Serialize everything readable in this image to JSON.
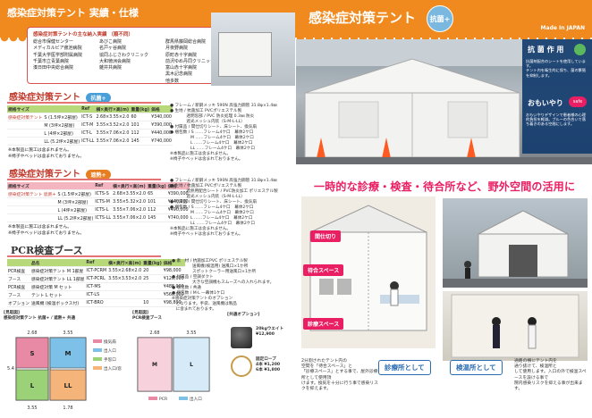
{
  "left": {
    "header_title": "感染症対策テント 実績・仕様",
    "hospital_box_title": "感染症対策テントの主な納入実績 （順不同）",
    "hospitals": [
      "総合市保健センター",
      "あびこ病院",
      "群馬県藤岡総合病院",
      "メディカルビア菰池病院",
      "名戸ヶ谷病院",
      "月夜野病院",
      "千葉大学医学部附属病院",
      "協同ふじさわクリニック",
      "原町赤十字病院",
      "千葉市立青葉病院",
      "大和徳洲会病院",
      "前沢ゆめ丹同クリニック",
      "湊日田中央総合病院",
      "雑井共病院",
      "富山赤十字病院",
      "",
      "",
      "黒木記念病院",
      "",
      "",
      "他多数"
    ],
    "section1_title": "感染症対策テント",
    "section1_badge": "抗菌+",
    "section2_title": "感染症対策テント",
    "section2_badge": "遮熱+",
    "section3_title": "PCR検査ブース",
    "table1": {
      "headers": [
        "規格サイズ",
        "",
        "Ref",
        "横×奥行×高(m)",
        "重量(kg)",
        "価格"
      ],
      "group_label": "感染症対策テント",
      "rows": [
        [
          "S (1.5坪×2部屋)",
          "ICT-S",
          "2.68×3.55×2.0",
          "60",
          "¥340,000"
        ],
        [
          "M (3坪×2部屋)",
          "ICT-M",
          "3.55×3.52×2.0",
          "101",
          "¥390,000"
        ],
        [
          "L (4坪×2部屋)",
          "ICT-L",
          "3.55×7.06×2.0",
          "112",
          "¥440,000"
        ],
        [
          "LL (5.2坪×2部屋)",
          "ICT-LL",
          "3.55×7.06×2.0",
          "145",
          "¥740,000"
        ]
      ],
      "note": "※本製品に施工は含まれません。\n※椅子やベッドは含まれておりません。"
    },
    "table2": {
      "headers": [
        "規格サイズ",
        "",
        "Ref",
        "横×奥行×高(m)",
        "重量(kg)",
        "価格"
      ],
      "group_label": "感染症対策テント 遮熱+",
      "rows": [
        [
          "S (1.5坪×2部屋)",
          "ICTS-S",
          "2.68×3.55×2.0",
          "65",
          "¥390,000"
        ],
        [
          "M (3坪×2部屋)",
          "ICTS-M",
          "3.55×5.32×2.0",
          "101",
          "¥440,000"
        ],
        [
          "L (4坪×2部屋)",
          "ICTS-L",
          "3.55×7.06×2.0",
          "112",
          "¥490,000"
        ],
        [
          "LL (5.2坪×2部屋)",
          "ICTS-LL",
          "3.55×7.06×2.0",
          "145",
          "¥740,000"
        ]
      ],
      "note": "※本製品に施工は含まれません。\n※椅子やベッドは含まれておりません。"
    },
    "spec1": "● フレーム / 新鋼メッキ 590N 高強力鋼管 31.8φ×1.4㎜\n● 生地 / 抗菌加工 PVCポリエステル製\n　　　　透明窓部 / PVC 防炎処理 0.3㎜ 防炎\n　　　　遮光メッシュ内装（S-M-L-LL）\n● 付属品 / 間仕切りシート、床シート、換気扇\n● 梱包数 / S ……フレーム4ケ口　幕体2ケ口\n　　　　　M ……フレーム4ケ口　幕体2ケ口\n　　　　　L ……フレーム4ケ口　幕体2ケ口\n　　　　　LL ……フレーム4ケ口　幕体2ケ口\n※本製品に施工は含まれません。\n※椅子やベッドは含まれておりません。",
    "spec2": "● フレーム / 新鋼メッキ 590N 高強力鋼管 31.8φ×1.4㎜\n● 生地 / 抗菌加工 PVCポリエステル製\n　　　　遮熱用配合シート / PVC防炎加工 ポリエステル製\n　　　　遮光メッシュ内装（S-M-L-LL）\n● 付属品 / 間仕切りシート、床シート、換気扇\n● 梱包数 / S ……フレーム4ケ口　幕体2ケ口\n　　　　　M ……フレーム4ケ口　幕体2ケ口\n　　　　　L ……フレーム4ケ口　幕体2ケ口\n　　　　　LL ……フレーム4ケ口　幕体2ケ口\n※本製品に施工は含まれません。\n※椅子やベッドは含まれておりません。",
    "pcr_table": {
      "headers": [
        "",
        "品名",
        "Ref",
        "横×奥行×高(m)",
        "重量(kg)",
        "価格"
      ],
      "rows": [
        [
          "PCR検査",
          "感染症対策テント M 1部屋",
          "ICT-PCRM",
          "3.55×2.68×2.0",
          "20",
          "¥98,000"
        ],
        [
          "ブース",
          "感染症対策テント LL 1部屋",
          "ICT-PCRL",
          "3.55×3.53×2.0",
          "25",
          "¥120,000"
        ],
        [
          "PCR検査",
          "感染症対策  M セット",
          "ICT-MS",
          "",
          "",
          "¥488,000"
        ],
        [
          "ブース",
          "テント  L セット",
          "ICT-LS",
          "",
          "",
          "¥560,000"
        ],
        [
          "オプション",
          "送風機 (検温ボックス付)",
          "ICT-BRO",
          "",
          "10",
          "¥98,800"
        ]
      ]
    },
    "pcr_spec": "● 素　材 / 抗菌加工PVC ポリエステル製\n　　　　　送風機(検温用) 送風口×1か所\n　　　　　スポットクーラー用送風口×1か所\n● 付属品 / 空調ダクト\n　　　　　大きな空調機もスムーズへの入れられます。\n● 梱包数 / 共通\n● 梱包数 / M·L ―幕体1ケ口\n※感染症対策テントのオプション\n　となります。手袋、送風機は製品\n　に含まれております。",
    "plan1_title": "[見取図]\n感染症対策テント 抗菌+ / 遮熱+ 共通",
    "plan2_title": "[見取図]\nPCR検査ブース",
    "plan_legend": [
      "換気扇",
      "出入口",
      "手窓口",
      "出入口/窓",
      "PCR"
    ],
    "plan_cells": [
      "S",
      "M",
      "L",
      "LL"
    ],
    "plan_dims": [
      "2.68",
      "3.55",
      "5.4",
      "1.78",
      "3.55",
      "2.68",
      "2.68",
      "3.55"
    ],
    "option_title": "[共通オプション]",
    "option1": "20kgウエイト\n¥12,900",
    "option2": "固定ロープ\n4本 ¥1,200\n6本 ¥1,800"
  },
  "right": {
    "header_title": "感染症対策テント",
    "header_badge": "抗菌+",
    "made_in": "Made In JAPAN",
    "side_title": "抗 菌 作 用",
    "side_text": "抗菌剤配合のシートを使用しています。\nテント内を衛生的に保ち、菌の繁殖を抑制します。",
    "side_title2": "おもいやり",
    "side_badge": "safe",
    "side_text2": "おもいやりデザインで患者様の心理的負担を軽減。ブルーの色合いで落ち着きのある空間にします。",
    "banner": "一時的な診療・検査・待合所など、野外空間の活用に",
    "tag_waiting": "待合スペース",
    "tag_exam": "診療スペース",
    "tag_float": "間仕切り",
    "btn_clinic": "診療所として",
    "btn_fever": "検温所として",
    "text_clinic": "2分割されたテント内の\n空間を「待合スペース」と\n「診療スペース」とする事で、屋外診療所として使用頂\nけます。換気を十分に行う事で感染リスクを抑えます。",
    "text_fever": "通路の横にテント内を\n通り抜けて、検温所と\nして使用します。入口の外で検温スペースを設ける事で\n院内感染リスクを抑える事が出来ます。"
  },
  "colors": {
    "orange": "#f08a1e",
    "red": "#c0392b",
    "pink": "#e91e63",
    "green": "#5cb85c",
    "blue": "#2b6cb0"
  }
}
